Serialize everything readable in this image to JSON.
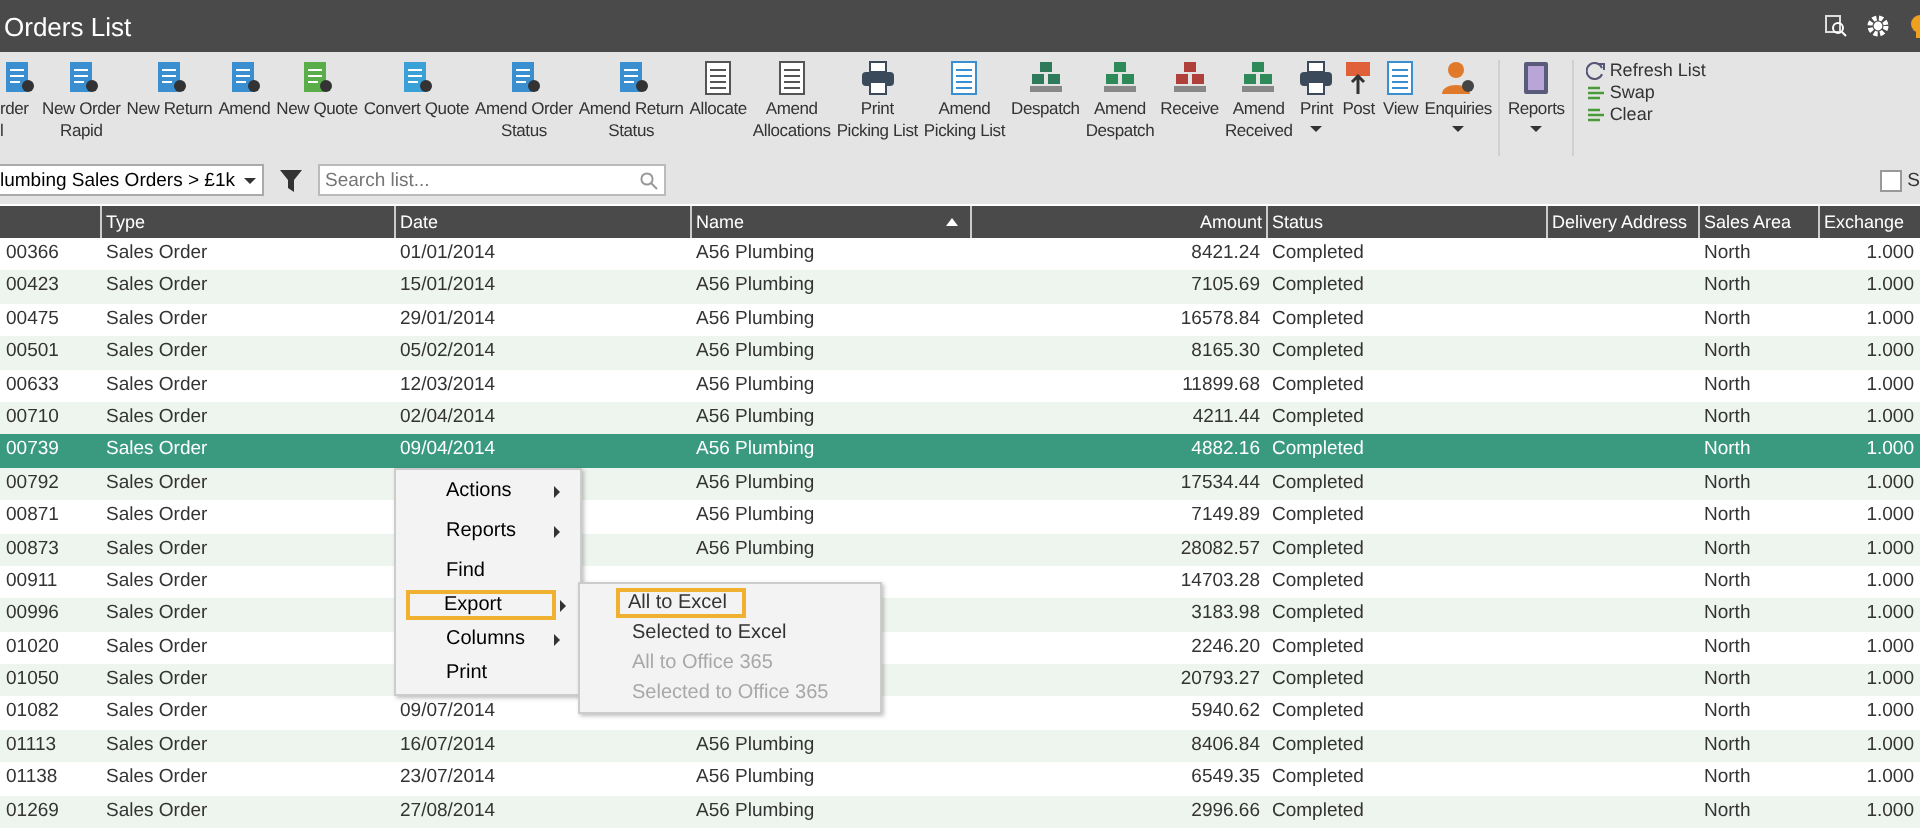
{
  "window": {
    "title": "Orders List"
  },
  "toolbar": {
    "buttons": [
      {
        "lines": [
          "rder",
          "l"
        ],
        "has_menu": false
      },
      {
        "lines": [
          "New Order",
          "Rapid"
        ],
        "has_menu": false
      },
      {
        "lines": [
          "New Return"
        ],
        "has_menu": false
      },
      {
        "lines": [
          "Amend"
        ],
        "has_menu": false
      },
      {
        "lines": [
          "New Quote"
        ],
        "has_menu": false
      },
      {
        "lines": [
          "Convert Quote"
        ],
        "has_menu": false
      },
      {
        "lines": [
          "Amend Order",
          "Status"
        ],
        "has_menu": false
      },
      {
        "lines": [
          "Amend Return",
          "Status"
        ],
        "has_menu": false
      },
      {
        "lines": [
          "Allocate"
        ],
        "has_menu": false
      },
      {
        "lines": [
          "Amend",
          "Allocations"
        ],
        "has_menu": false
      },
      {
        "lines": [
          "Print",
          "Picking List"
        ],
        "has_menu": false
      },
      {
        "lines": [
          "Amend",
          "Picking List"
        ],
        "has_menu": false
      },
      {
        "lines": [
          "Despatch"
        ],
        "has_menu": false
      },
      {
        "lines": [
          "Amend",
          "Despatch"
        ],
        "has_menu": false
      },
      {
        "lines": [
          "Receive"
        ],
        "has_menu": false
      },
      {
        "lines": [
          "Amend",
          "Received"
        ],
        "has_menu": false
      },
      {
        "lines": [
          "Print"
        ],
        "has_menu": true
      },
      {
        "lines": [
          "Post"
        ],
        "has_menu": false
      },
      {
        "lines": [
          "View"
        ],
        "has_menu": false
      },
      {
        "lines": [
          "Enquiries"
        ],
        "has_menu": true
      },
      {
        "lines": [
          "Reports"
        ],
        "has_menu": true
      }
    ],
    "list_actions": [
      "Refresh List",
      "Swap",
      "Clear"
    ]
  },
  "filter_bar": {
    "view": "lumbing Sales Orders > £1k",
    "search": {
      "placeholder": "Search list..."
    },
    "checkbox": {
      "label": "S",
      "checked": false
    }
  },
  "table": {
    "columns": [
      {
        "sorted": false
      },
      {
        "label": "Type",
        "sorted": false
      },
      {
        "label": "Date",
        "sorted": false
      },
      {
        "label": "Name",
        "sorted": true
      },
      {
        "label": "Amount",
        "sorted": false
      },
      {
        "label": "Status",
        "sorted": false
      },
      {
        "label": "Delivery Address",
        "sorted": false
      },
      {
        "label": "Sales Area",
        "sorted": false
      },
      {
        "label": "Exchange",
        "sorted": false
      }
    ],
    "rows": [
      {
        "number": "00366",
        "type": "Sales Order",
        "date": "01/01/2014",
        "name": "A56 Plumbing",
        "amount": "8421.24",
        "status": "Completed",
        "sales_area": "North",
        "exchange": "1.000",
        "selected": false
      },
      {
        "number": "00423",
        "type": "Sales Order",
        "date": "15/01/2014",
        "name": "A56 Plumbing",
        "amount": "7105.69",
        "status": "Completed",
        "sales_area": "North",
        "exchange": "1.000",
        "selected": false
      },
      {
        "number": "00475",
        "type": "Sales Order",
        "date": "29/01/2014",
        "name": "A56 Plumbing",
        "amount": "16578.84",
        "status": "Completed",
        "sales_area": "North",
        "exchange": "1.000",
        "selected": false
      },
      {
        "number": "00501",
        "type": "Sales Order",
        "date": "05/02/2014",
        "name": "A56 Plumbing",
        "amount": "8165.30",
        "status": "Completed",
        "sales_area": "North",
        "exchange": "1.000",
        "selected": false
      },
      {
        "number": "00633",
        "type": "Sales Order",
        "date": "12/03/2014",
        "name": "A56 Plumbing",
        "amount": "11899.68",
        "status": "Completed",
        "sales_area": "North",
        "exchange": "1.000",
        "selected": false
      },
      {
        "number": "00710",
        "type": "Sales Order",
        "date": "02/04/2014",
        "name": "A56 Plumbing",
        "amount": "4211.44",
        "status": "Completed",
        "sales_area": "North",
        "exchange": "1.000",
        "selected": false
      },
      {
        "number": "00739",
        "type": "Sales Order",
        "date": "09/04/2014",
        "name": "A56 Plumbing",
        "amount": "4882.16",
        "status": "Completed",
        "sales_area": "North",
        "exchange": "1.000",
        "selected": true
      },
      {
        "number": "00792",
        "type": "Sales Order",
        "name": "A56 Plumbing",
        "amount": "17534.44",
        "status": "Completed",
        "sales_area": "North",
        "exchange": "1.000",
        "selected": false
      },
      {
        "number": "00871",
        "type": "Sales Order",
        "name": "A56 Plumbing",
        "amount": "7149.89",
        "status": "Completed",
        "sales_area": "North",
        "exchange": "1.000",
        "selected": false
      },
      {
        "number": "00873",
        "type": "Sales Order",
        "name": "A56 Plumbing",
        "amount": "28082.57",
        "status": "Completed",
        "sales_area": "North",
        "exchange": "1.000",
        "selected": false
      },
      {
        "number": "00911",
        "type": "Sales Order",
        "amount": "14703.28",
        "status": "Completed",
        "sales_area": "North",
        "exchange": "1.000",
        "selected": false
      },
      {
        "number": "00996",
        "type": "Sales Order",
        "amount": "3183.98",
        "status": "Completed",
        "sales_area": "North",
        "exchange": "1.000",
        "selected": false
      },
      {
        "number": "01020",
        "type": "Sales Order",
        "amount": "2246.20",
        "status": "Completed",
        "sales_area": "North",
        "exchange": "1.000",
        "selected": false
      },
      {
        "number": "01050",
        "type": "Sales Order",
        "amount": "20793.27",
        "status": "Completed",
        "sales_area": "North",
        "exchange": "1.000",
        "selected": false
      },
      {
        "number": "01082",
        "type": "Sales Order",
        "date": "09/07/2014",
        "amount": "5940.62",
        "status": "Completed",
        "sales_area": "North",
        "exchange": "1.000",
        "selected": false
      },
      {
        "number": "01113",
        "type": "Sales Order",
        "date": "16/07/2014",
        "name": "A56 Plumbing",
        "amount": "8406.84",
        "status": "Completed",
        "sales_area": "North",
        "exchange": "1.000",
        "selected": false
      },
      {
        "number": "01138",
        "type": "Sales Order",
        "date": "23/07/2014",
        "name": "A56 Plumbing",
        "amount": "6549.35",
        "status": "Completed",
        "sales_area": "North",
        "exchange": "1.000",
        "selected": false
      },
      {
        "number": "01269",
        "type": "Sales Order",
        "date": "27/08/2014",
        "name": "A56 Plumbing",
        "amount": "2996.66",
        "status": "Completed",
        "sales_area": "North",
        "exchange": "1.000",
        "selected": false
      }
    ]
  },
  "context_menu": {
    "items": [
      {
        "label": "Actions",
        "has_submenu": true,
        "selected": false
      },
      {
        "label": "Reports",
        "has_submenu": true,
        "selected": false
      },
      {
        "label": "Find",
        "has_submenu": false,
        "selected": false
      },
      {
        "label": "Export",
        "has_submenu": true,
        "selected": true
      },
      {
        "label": "Columns",
        "has_submenu": true,
        "selected": false
      },
      {
        "label": "Print",
        "has_submenu": false,
        "selected": false
      }
    ],
    "submenu": [
      {
        "label": "All to Excel",
        "disabled": false,
        "selected": true
      },
      {
        "label": "Selected to Excel",
        "disabled": false,
        "selected": false
      },
      {
        "label": "All to Office 365",
        "disabled": true,
        "selected": false
      },
      {
        "label": "Selected to Office 365",
        "disabled": true,
        "selected": false
      }
    ]
  }
}
